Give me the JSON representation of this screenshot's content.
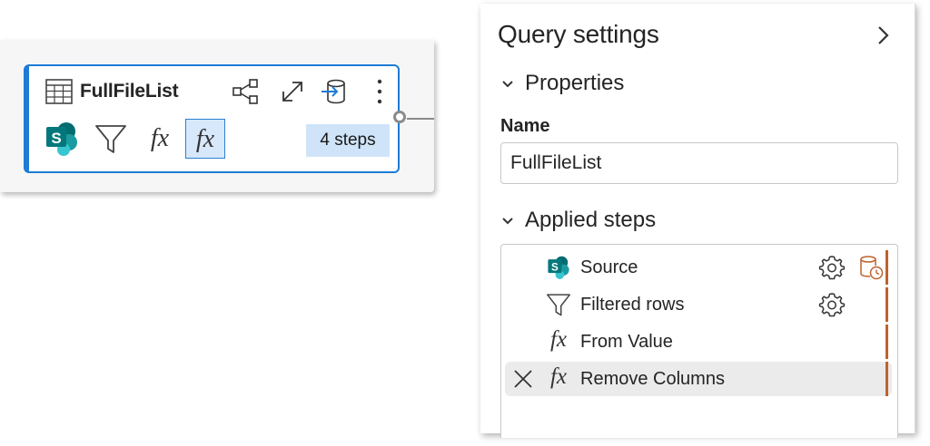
{
  "query_card": {
    "title": "FullFileList",
    "steps_badge": "4 steps",
    "steps": [
      {
        "icon": "sharepoint-icon",
        "letter": "S"
      },
      {
        "icon": "filter-icon"
      },
      {
        "icon": "fx-icon",
        "glyph": "fx"
      },
      {
        "icon": "fx-icon",
        "glyph": "fx",
        "selected": true
      }
    ],
    "actions": [
      "share-icon",
      "expand-icon",
      "load-to-destination-icon",
      "more-options-icon"
    ]
  },
  "panel": {
    "title": "Query settings",
    "properties_heading": "Properties",
    "name_label": "Name",
    "name_value": "FullFileList",
    "applied_steps_heading": "Applied steps",
    "steps": [
      {
        "label": "Source",
        "icon": "sharepoint-icon",
        "letter": "S",
        "has_settings": true,
        "has_destination_icon": true
      },
      {
        "label": "Filtered rows",
        "icon": "filter-icon",
        "has_settings": true
      },
      {
        "label": "From Value",
        "icon": "fx-icon",
        "glyph": "fx"
      },
      {
        "label": "Remove Columns",
        "icon": "fx-icon",
        "glyph": "fx",
        "selected": true,
        "has_delete": true
      }
    ]
  },
  "colors": {
    "accent_blue": "#1e7bd6",
    "badge_bg": "#cfe4f8",
    "step_indicator": "#c0622b",
    "sharepoint_teal": "#038387"
  }
}
